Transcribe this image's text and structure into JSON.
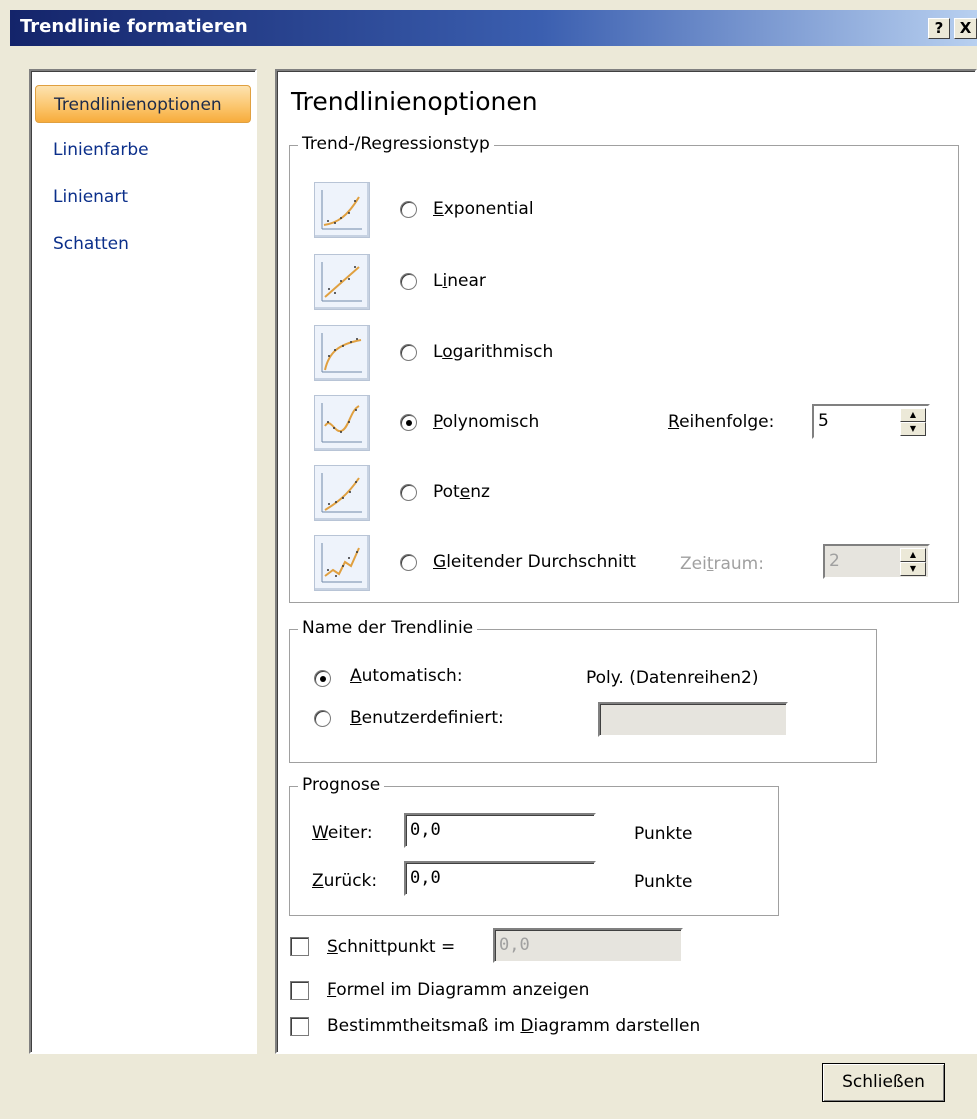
{
  "window": {
    "title": "Trendlinie formatieren",
    "help_button": "?",
    "close_button": "X"
  },
  "nav": {
    "items": [
      {
        "label": "Trendlinienoptionen",
        "active": true
      },
      {
        "label": "Linienfarbe",
        "active": false
      },
      {
        "label": "Linienart",
        "active": false
      },
      {
        "label": "Schatten",
        "active": false
      }
    ]
  },
  "panel": {
    "heading": "Trendlinienoptionen",
    "trend_group": {
      "legend": "Trend-/Regressionstyp",
      "options": [
        {
          "label": "Exponential",
          "icon": "exponential-trend-icon",
          "selected": false
        },
        {
          "label": "Linear",
          "icon": "linear-trend-icon",
          "selected": false
        },
        {
          "label": "Logarithmisch",
          "icon": "logarithmic-trend-icon",
          "selected": false
        },
        {
          "label": "Polynomisch",
          "icon": "polynomial-trend-icon",
          "selected": true
        },
        {
          "label": "Potenz",
          "icon": "power-trend-icon",
          "selected": false
        },
        {
          "label": "Gleitender Durchschnitt",
          "icon": "moving-average-trend-icon",
          "selected": false
        }
      ],
      "order_label": "Reihenfolge:",
      "order_value": "5",
      "period_label": "Zeitraum:",
      "period_value": "2"
    },
    "name_group": {
      "legend": "Name der Trendlinie",
      "automatic_label": "Automatisch:",
      "automatic_value": "Poly. (Datenreihen2)",
      "custom_label": "Benutzerdefiniert:",
      "custom_value": "",
      "automatic_selected": true
    },
    "forecast_group": {
      "legend": "Prognose",
      "forward_label": "Weiter:",
      "forward_value": "0,0",
      "forward_unit": "Punkte",
      "backward_label": "Zurück:",
      "backward_value": "0,0",
      "backward_unit": "Punkte"
    },
    "intercept_label": "Schnittpunkt =",
    "intercept_value": "0,0",
    "show_formula_label": "Formel im Diagramm anzeigen",
    "show_r2_label": "Bestimmtheitsmaß im Diagramm darstellen"
  },
  "footer": {
    "close_label": "Schließen"
  }
}
